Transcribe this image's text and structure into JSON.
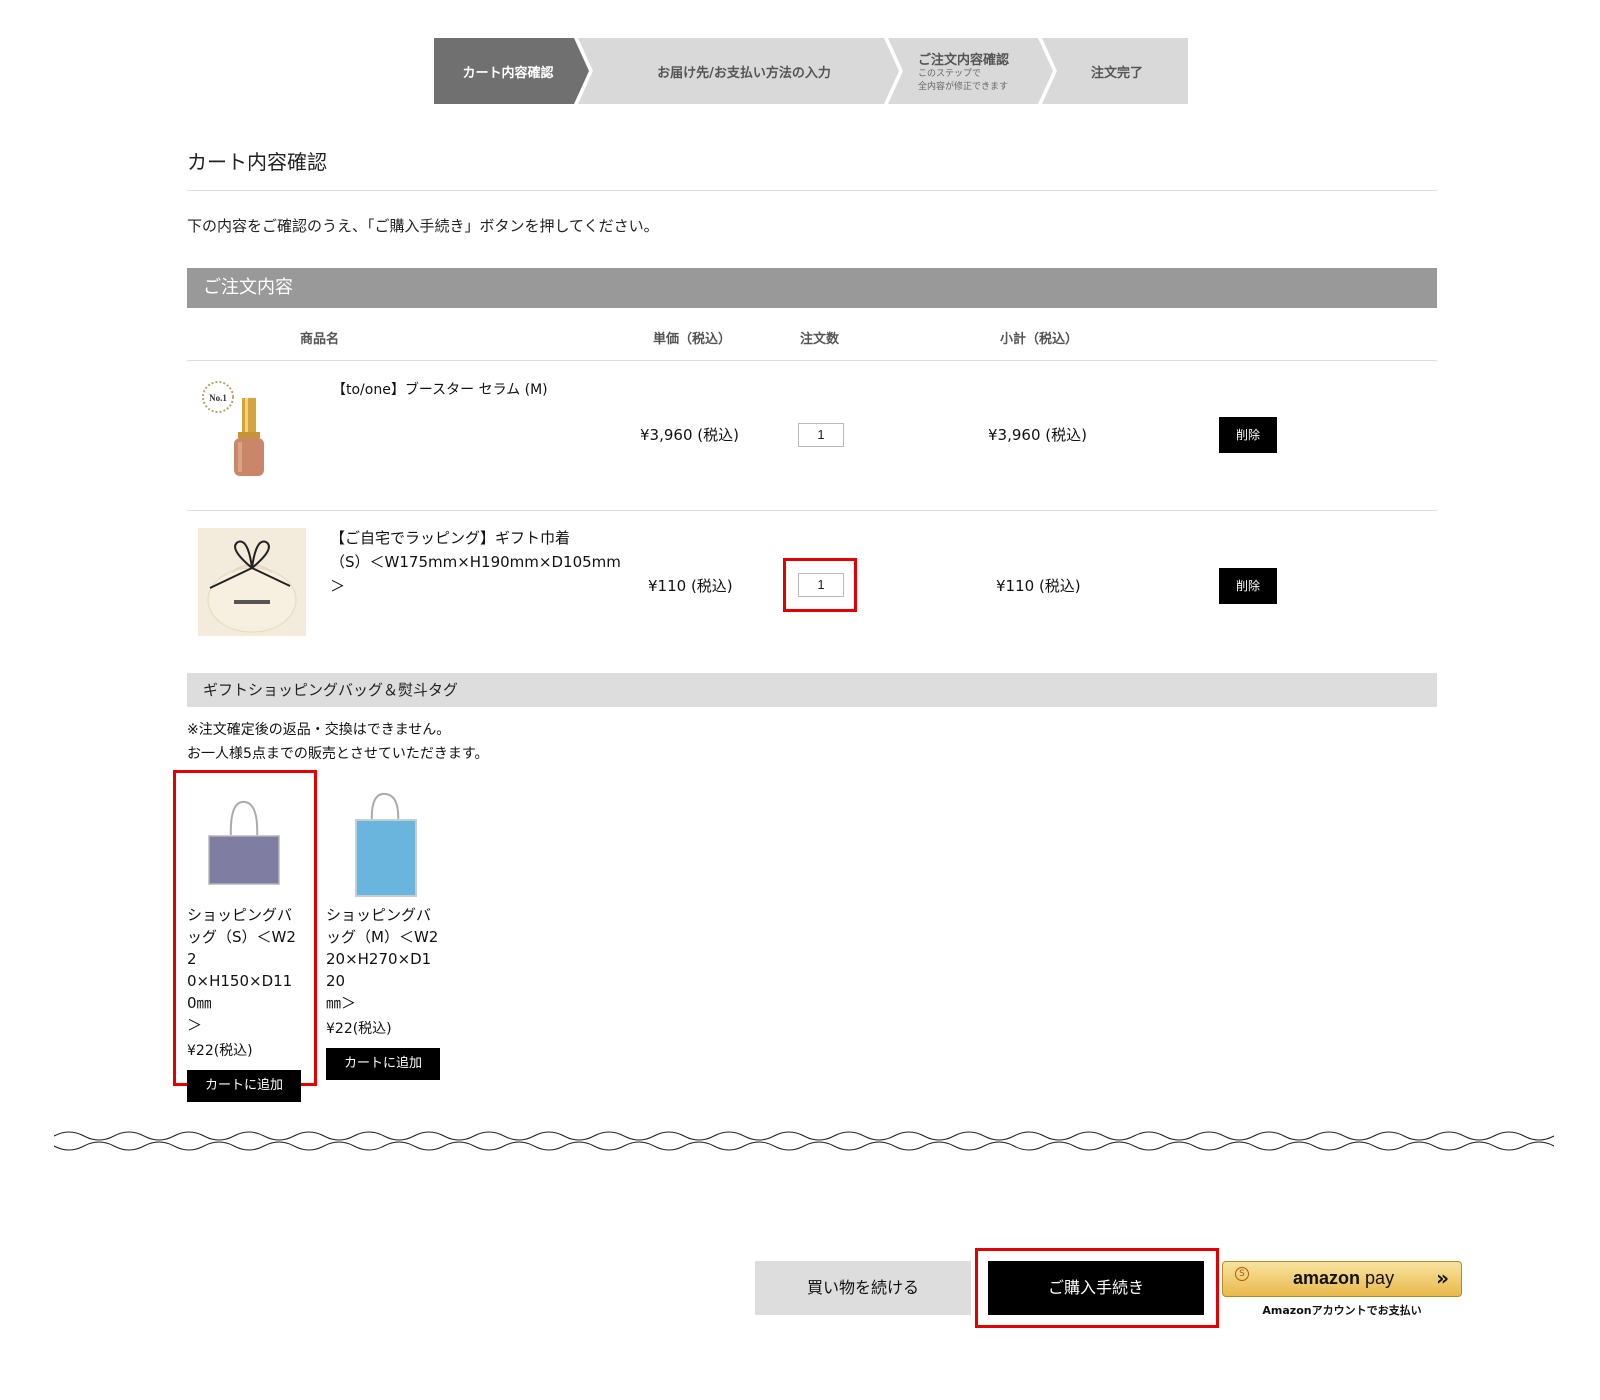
{
  "steps": [
    {
      "label": "カート内容確認"
    },
    {
      "label": "お届け先/お支払い方法の入力"
    },
    {
      "label": "ご注文内容確認",
      "sub1": "このステップで",
      "sub2": "全内容が修正できます"
    },
    {
      "label": "注文完了"
    }
  ],
  "page": {
    "title": "カート内容確認",
    "intro": "下の内容をご確認のうえ、「ご購入手続き」ボタンを押してください。"
  },
  "order": {
    "section_title": "ご注文内容",
    "headers": {
      "name": "商品名",
      "unit_price": "単価（税込）",
      "qty": "注文数",
      "subtotal": "小計（税込）"
    },
    "items": [
      {
        "name": "【to/one】ブースター セラム (M)",
        "unit_price": "¥3,960 (税込)",
        "qty": "1",
        "subtotal": "¥3,960 (税込)",
        "delete": "削除",
        "badge": "No.1"
      },
      {
        "name_line1": "【ご自宅でラッピング】ギフト巾着",
        "name_line2": "（S）＜W175mm×H190mm×D105mm",
        "name_line3": "＞",
        "unit_price": "¥110 (税込)",
        "qty": "1",
        "subtotal": "¥110 (税込)",
        "delete": "削除"
      }
    ]
  },
  "gift": {
    "section_title": "ギフトショッピングバッグ＆熨斗タグ",
    "note1": "※注文確定後の返品・交換はできません。",
    "note2": "お一人様5点までの販売とさせていただきます。",
    "bags": [
      {
        "name_lines": [
          "ショッピングバ",
          "ッグ（S）＜W22",
          "0×H150×D110㎜",
          "＞"
        ],
        "price": "¥22(税込)",
        "button": "カートに追加",
        "color": "#7d7a9a"
      },
      {
        "name_lines": [
          "ショッピングバ",
          "ッグ（M）＜W2",
          "20×H270×D120",
          "㎜＞"
        ],
        "price": "¥22(税込)",
        "button": "カートに追加",
        "color": "#4da6d8"
      }
    ]
  },
  "actions": {
    "continue": "買い物を続ける",
    "purchase": "ご購入手続き",
    "amazon_brand": "amazon",
    "amazon_pay": "pay",
    "amazon_caption": "Amazonアカウントでお支払い"
  }
}
